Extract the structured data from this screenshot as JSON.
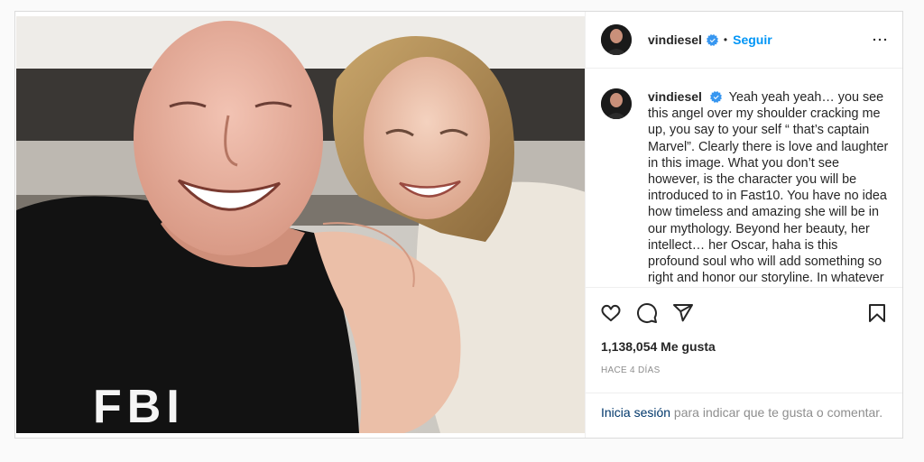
{
  "post": {
    "username": "vindiesel",
    "verified": true,
    "follow_label": "Seguir",
    "separator": "•",
    "caption": "Yeah yeah yeah… you see this angel over my shoulder cracking me up, you say to your self “ that’s captain Marvel”. Clearly there is love and laughter in this image. What you don’t see however, is the character you will be introduced to in Fast10. You have no idea how timeless and amazing she will be in our mythology. Beyond her beauty, her intellect… her Oscar, haha is this profound soul who will add something so right and honor our storyline. In whatever universe we are in, she is beautiful.",
    "likes": "1,138,054 Me gusta",
    "timestamp": "HACE 4 DÍAS",
    "login_link": "Inicia sesión",
    "login_rest": " para indicar que te gusta o comentar."
  },
  "photo": {
    "shirt_text": "FBI"
  },
  "icons": {
    "verified": "verified-badge-icon",
    "more": "more-options-icon",
    "like": "heart-icon",
    "comment": "comment-icon",
    "share": "share-icon",
    "save": "bookmark-icon"
  },
  "colors": {
    "accent": "#0095f6",
    "verified": "#3897f0",
    "link": "#00376b",
    "muted": "#8e8e8e",
    "border": "#dbdbdb"
  }
}
